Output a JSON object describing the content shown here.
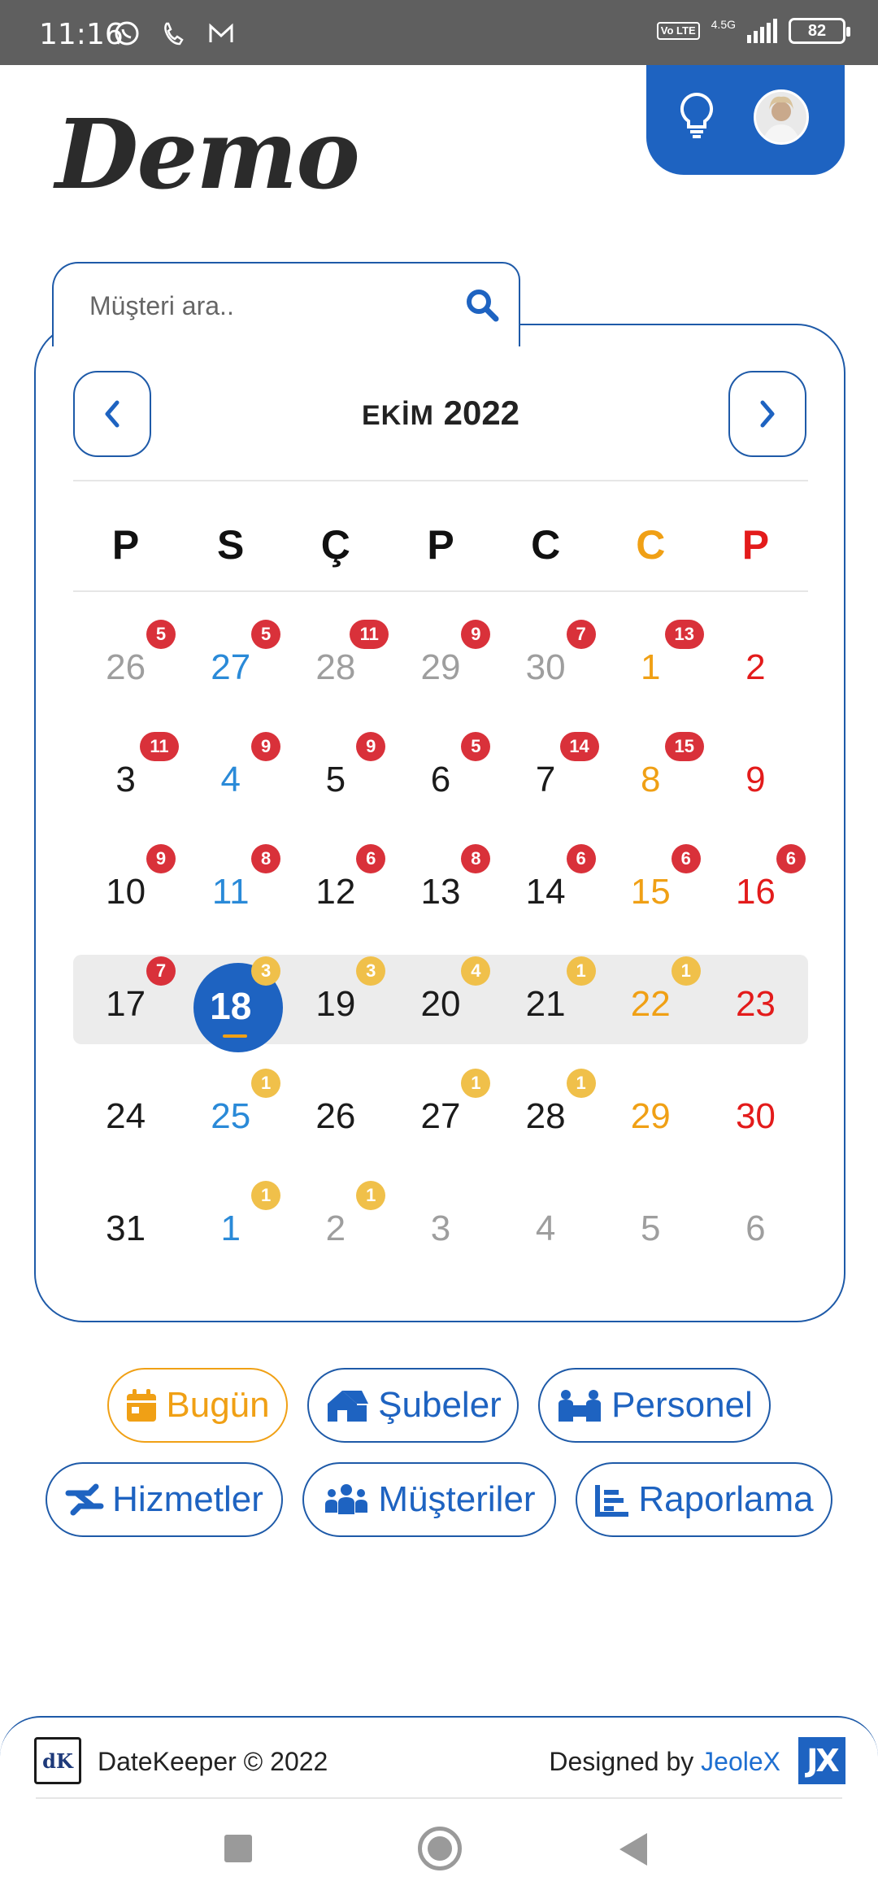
{
  "status_bar": {
    "time": "11:16",
    "network": "4.5G",
    "volte": "Vo LTE",
    "battery": "82"
  },
  "app": {
    "logo_text": "Demo"
  },
  "search": {
    "placeholder": "Müşteri ara.."
  },
  "calendar": {
    "month": "EKİM",
    "year": "2022",
    "weekdays": [
      {
        "label": "P",
        "type": "weekday"
      },
      {
        "label": "S",
        "type": "weekday"
      },
      {
        "label": "Ç",
        "type": "weekday"
      },
      {
        "label": "P",
        "type": "weekday"
      },
      {
        "label": "C",
        "type": "weekday"
      },
      {
        "label": "C",
        "type": "sat"
      },
      {
        "label": "P",
        "type": "sun"
      }
    ],
    "weeks": [
      [
        {
          "day": "26",
          "style": "muted",
          "badge": "5",
          "badge_color": "red"
        },
        {
          "day": "27",
          "style": "blue",
          "badge": "5",
          "badge_color": "red"
        },
        {
          "day": "28",
          "style": "muted",
          "badge": "11",
          "badge_color": "red"
        },
        {
          "day": "29",
          "style": "muted",
          "badge": "9",
          "badge_color": "red"
        },
        {
          "day": "30",
          "style": "muted",
          "badge": "7",
          "badge_color": "red"
        },
        {
          "day": "1",
          "style": "sat",
          "badge": "13",
          "badge_color": "red"
        },
        {
          "day": "2",
          "style": "sun",
          "badge": "",
          "badge_color": ""
        }
      ],
      [
        {
          "day": "3",
          "style": "normal",
          "badge": "11",
          "badge_color": "red"
        },
        {
          "day": "4",
          "style": "blue",
          "badge": "9",
          "badge_color": "red"
        },
        {
          "day": "5",
          "style": "normal",
          "badge": "9",
          "badge_color": "red"
        },
        {
          "day": "6",
          "style": "normal",
          "badge": "5",
          "badge_color": "red"
        },
        {
          "day": "7",
          "style": "normal",
          "badge": "14",
          "badge_color": "red"
        },
        {
          "day": "8",
          "style": "sat",
          "badge": "15",
          "badge_color": "red"
        },
        {
          "day": "9",
          "style": "sun",
          "badge": "",
          "badge_color": ""
        }
      ],
      [
        {
          "day": "10",
          "style": "normal",
          "badge": "9",
          "badge_color": "red"
        },
        {
          "day": "11",
          "style": "blue",
          "badge": "8",
          "badge_color": "red"
        },
        {
          "day": "12",
          "style": "normal",
          "badge": "6",
          "badge_color": "red"
        },
        {
          "day": "13",
          "style": "normal",
          "badge": "8",
          "badge_color": "red"
        },
        {
          "day": "14",
          "style": "normal",
          "badge": "6",
          "badge_color": "red"
        },
        {
          "day": "15",
          "style": "sat",
          "badge": "6",
          "badge_color": "red"
        },
        {
          "day": "16",
          "style": "sun",
          "badge": "6",
          "badge_color": "red"
        }
      ],
      [
        {
          "day": "17",
          "style": "normal",
          "badge": "7",
          "badge_color": "red"
        },
        {
          "day": "18",
          "style": "today",
          "badge": "3",
          "badge_color": "yellow"
        },
        {
          "day": "19",
          "style": "normal",
          "badge": "3",
          "badge_color": "yellow"
        },
        {
          "day": "20",
          "style": "normal",
          "badge": "4",
          "badge_color": "yellow"
        },
        {
          "day": "21",
          "style": "normal",
          "badge": "1",
          "badge_color": "yellow"
        },
        {
          "day": "22",
          "style": "sat",
          "badge": "1",
          "badge_color": "yellow"
        },
        {
          "day": "23",
          "style": "sun",
          "badge": "",
          "badge_color": ""
        }
      ],
      [
        {
          "day": "24",
          "style": "normal",
          "badge": "",
          "badge_color": ""
        },
        {
          "day": "25",
          "style": "blue",
          "badge": "1",
          "badge_color": "yellow"
        },
        {
          "day": "26",
          "style": "normal",
          "badge": "",
          "badge_color": ""
        },
        {
          "day": "27",
          "style": "normal",
          "badge": "1",
          "badge_color": "yellow"
        },
        {
          "day": "28",
          "style": "normal",
          "badge": "1",
          "badge_color": "yellow"
        },
        {
          "day": "29",
          "style": "sat",
          "badge": "",
          "badge_color": ""
        },
        {
          "day": "30",
          "style": "sun",
          "badge": "",
          "badge_color": ""
        }
      ],
      [
        {
          "day": "31",
          "style": "normal",
          "badge": "",
          "badge_color": ""
        },
        {
          "day": "1",
          "style": "blue",
          "badge": "1",
          "badge_color": "yellow"
        },
        {
          "day": "2",
          "style": "muted",
          "badge": "1",
          "badge_color": "yellow"
        },
        {
          "day": "3",
          "style": "muted",
          "badge": "",
          "badge_color": ""
        },
        {
          "day": "4",
          "style": "muted",
          "badge": "",
          "badge_color": ""
        },
        {
          "day": "5",
          "style": "muted",
          "badge": "",
          "badge_color": ""
        },
        {
          "day": "6",
          "style": "muted",
          "badge": "",
          "badge_color": ""
        }
      ]
    ]
  },
  "actions": {
    "today": "Bugün",
    "branches": "Şubeler",
    "staff": "Personel",
    "services": "Hizmetler",
    "customers": "Müşteriler",
    "reports": "Raporlama"
  },
  "footer": {
    "logo_text": "dK",
    "copyright": "DateKeeper © 2022",
    "designed_by": "Designed by ",
    "designer": "JeoleX",
    "designer_logo": "JX"
  },
  "colors": {
    "primary": "#1e63c1",
    "accent": "#f0a015",
    "sunday": "#e31b1b",
    "badge_red": "#d9313a",
    "badge_yellow": "#f0c04a"
  }
}
